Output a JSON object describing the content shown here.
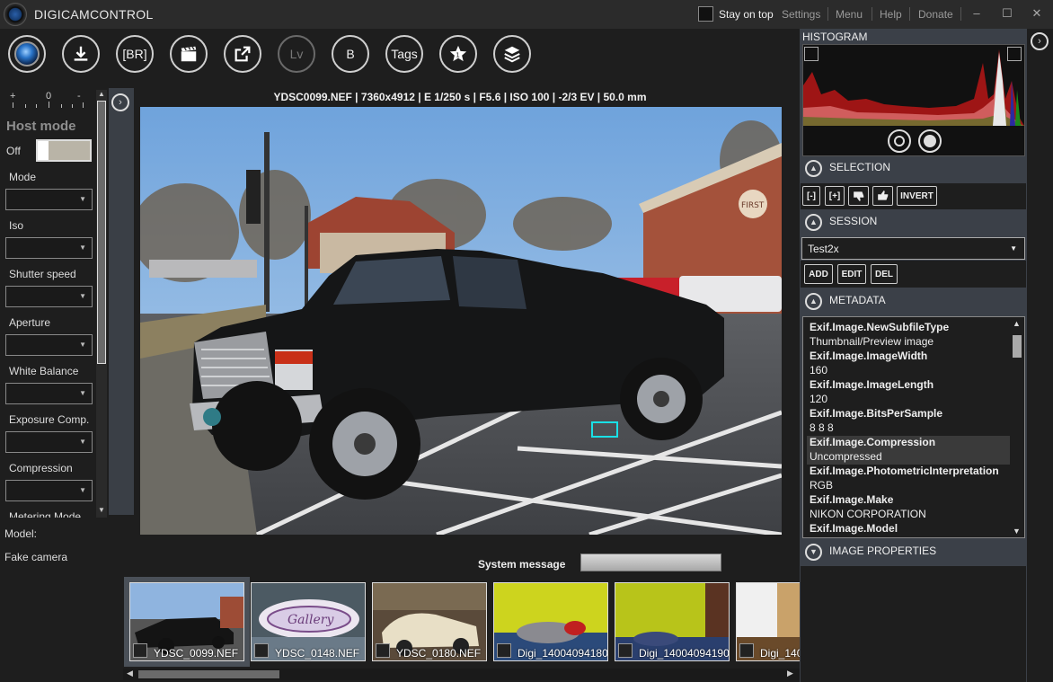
{
  "app": {
    "title": "DIGICAMCONTROL",
    "stay_on_top": "Stay on top",
    "menu": [
      "Settings",
      "Menu",
      "Help",
      "Donate"
    ],
    "window_controls": {
      "minimize": "–",
      "maximize": "☐",
      "close": "✕"
    }
  },
  "toolbar": {
    "capture_icon": "camera-lens-icon",
    "download_icon": "download-icon",
    "br_label": "[BR]",
    "movie_icon": "clapperboard-icon",
    "open_icon": "external-open-icon",
    "lv_label": "Lv",
    "b_label": "B",
    "tags_label": "Tags",
    "star_icon": "star-icon",
    "layers_icon": "layers-icon"
  },
  "left_panel": {
    "ev_scale": [
      "+",
      "0",
      "-"
    ],
    "host_mode": "Host mode",
    "off_label": "Off",
    "properties": [
      {
        "label": "Mode",
        "value": ""
      },
      {
        "label": "Iso",
        "value": ""
      },
      {
        "label": "Shutter speed",
        "value": ""
      },
      {
        "label": "Aperture",
        "value": ""
      },
      {
        "label": "White Balance",
        "value": ""
      },
      {
        "label": "Exposure Comp.",
        "value": ""
      },
      {
        "label": "Compression",
        "value": ""
      },
      {
        "label": "Metering Mode",
        "value": ""
      }
    ],
    "model_label": "Model:",
    "model_value": "Fake camera"
  },
  "image": {
    "caption": "YDSC0099.NEF | 7360x4912 | E 1/250 s | F5.6 | ISO 100 | -2/3 EV | 50.0 mm",
    "sign_text": "FIRST"
  },
  "system_message": {
    "label": "System message"
  },
  "thumbnails": [
    {
      "name": "YDSC_0099.NEF",
      "selected": true
    },
    {
      "name": "YDSC_0148.NEF",
      "selected": false
    },
    {
      "name": "YDSC_0180.NEF",
      "selected": false
    },
    {
      "name": "Digi_14004094180",
      "selected": false
    },
    {
      "name": "Digi_14004094190",
      "selected": false
    },
    {
      "name": "Digi_140",
      "selected": false
    }
  ],
  "right_panel": {
    "histogram_title": "HISTOGRAM",
    "selection": {
      "title": "SELECTION",
      "buttons": [
        "[-]",
        "[+]",
        "thumbs-down-icon",
        "thumbs-up-icon",
        "INVERT"
      ]
    },
    "session": {
      "title": "SESSION",
      "value": "Test2x",
      "buttons": [
        "ADD",
        "EDIT",
        "DEL"
      ]
    },
    "metadata": {
      "title": "METADATA",
      "rows": [
        {
          "text": "Exif.Image.NewSubfileType",
          "key": true
        },
        {
          "text": "Thumbnail/Preview image",
          "key": false
        },
        {
          "text": "Exif.Image.ImageWidth",
          "key": true
        },
        {
          "text": "160",
          "key": false
        },
        {
          "text": "Exif.Image.ImageLength",
          "key": true
        },
        {
          "text": "120",
          "key": false
        },
        {
          "text": "Exif.Image.BitsPerSample",
          "key": true
        },
        {
          "text": "8 8 8",
          "key": false
        },
        {
          "text": "Exif.Image.Compression",
          "key": true,
          "highlight": true
        },
        {
          "text": "Uncompressed",
          "key": false,
          "highlight": true
        },
        {
          "text": "Exif.Image.PhotometricInterpretation",
          "key": true
        },
        {
          "text": "RGB",
          "key": false
        },
        {
          "text": "Exif.Image.Make",
          "key": true
        },
        {
          "text": "NIKON CORPORATION",
          "key": false
        },
        {
          "text": "Exif.Image.Model",
          "key": true
        }
      ]
    },
    "image_properties": {
      "title": "IMAGE PROPERTIES"
    }
  }
}
